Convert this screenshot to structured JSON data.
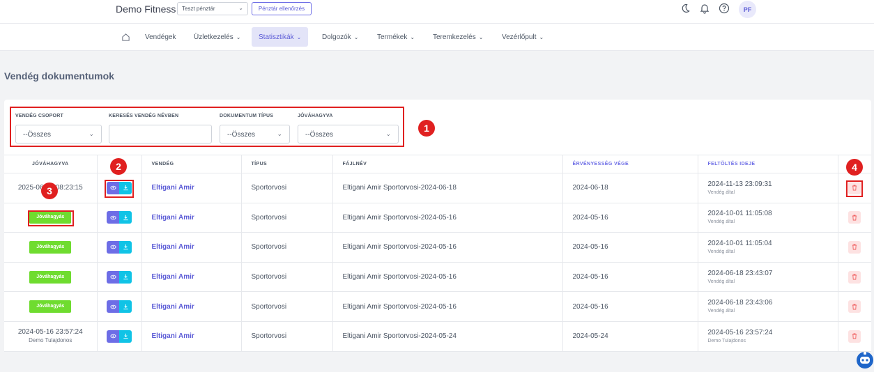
{
  "topbar": {
    "brand": "Demo Fitness",
    "register_select": "Teszt pénztár",
    "check_button": "Pénztár ellenőrzés",
    "avatar_initials": "PF"
  },
  "nav": {
    "items": [
      {
        "label": "Vendégek"
      },
      {
        "label": "Üzletkezelés"
      },
      {
        "label": "Statisztikák"
      },
      {
        "label": "Dolgozók"
      },
      {
        "label": "Termékek"
      },
      {
        "label": "Teremkezelés"
      },
      {
        "label": "Vezérlőpult"
      }
    ]
  },
  "page": {
    "title": "Vendég dokumentumok"
  },
  "filters": {
    "group_label": "VENDÉG CSOPORT",
    "group_value": "--Összes",
    "search_label": "KERESÉS VENDÉG NÉVBEN",
    "search_value": "",
    "doctype_label": "DOKUMENTUM TÍPUS",
    "doctype_value": "--Összes",
    "approved_label": "JÓVÁHAGYVA",
    "approved_value": "--Összes"
  },
  "table": {
    "headers": [
      "JÓVÁHAGYVA",
      "",
      "VENDÉG",
      "TÍPUS",
      "FÁJLNÉV",
      "ÉRVÉNYESSÉG VÉGE",
      "FELTÖLTÉS IDEJE",
      ""
    ],
    "approve_label": "Jóváhagyás",
    "rows": [
      {
        "approved": "2025-06-15 08:23:15",
        "approved_by": "",
        "guest": "Eltigani Amir",
        "type": "Sportorvosi",
        "file": "Eltigani Amir Sportorvosi-2024-06-18",
        "expiry": "2024-06-18",
        "uploaded": "2024-11-13 23:09:31",
        "uploaded_by": "Vendég által"
      },
      {
        "approved": "",
        "approved_by": "",
        "guest": "Eltigani Amir",
        "type": "Sportorvosi",
        "file": "Eltigani Amir Sportorvosi-2024-05-16",
        "expiry": "2024-05-16",
        "uploaded": "2024-10-01 11:05:08",
        "uploaded_by": "Vendég által"
      },
      {
        "approved": "",
        "approved_by": "",
        "guest": "Eltigani Amir",
        "type": "Sportorvosi",
        "file": "Eltigani Amir Sportorvosi-2024-05-16",
        "expiry": "2024-05-16",
        "uploaded": "2024-10-01 11:05:04",
        "uploaded_by": "Vendég által"
      },
      {
        "approved": "",
        "approved_by": "",
        "guest": "Eltigani Amir",
        "type": "Sportorvosi",
        "file": "Eltigani Amir Sportorvosi-2024-05-16",
        "expiry": "2024-05-16",
        "uploaded": "2024-06-18 23:43:07",
        "uploaded_by": "Vendég által"
      },
      {
        "approved": "",
        "approved_by": "",
        "guest": "Eltigani Amir",
        "type": "Sportorvosi",
        "file": "Eltigani Amir Sportorvosi-2024-05-16",
        "expiry": "2024-05-16",
        "uploaded": "2024-06-18 23:43:06",
        "uploaded_by": "Vendég által"
      },
      {
        "approved": "2024-05-16 23:57:24",
        "approved_by": "Demo Tulajdonos",
        "guest": "Eltigani Amir",
        "type": "Sportorvosi",
        "file": "Eltigani Amir Sportorvosi-2024-05-24",
        "expiry": "2024-05-24",
        "uploaded": "2024-05-16 23:57:24",
        "uploaded_by": "Demo Tulajdonos"
      }
    ]
  },
  "annotations": [
    "1",
    "2",
    "3",
    "4"
  ],
  "colors": {
    "accent": "#5b5bd6",
    "approve_green": "#6fdc2f",
    "download_cyan": "#10c3e6",
    "delete_red": "#f06060",
    "annotation_red": "#e02020"
  }
}
